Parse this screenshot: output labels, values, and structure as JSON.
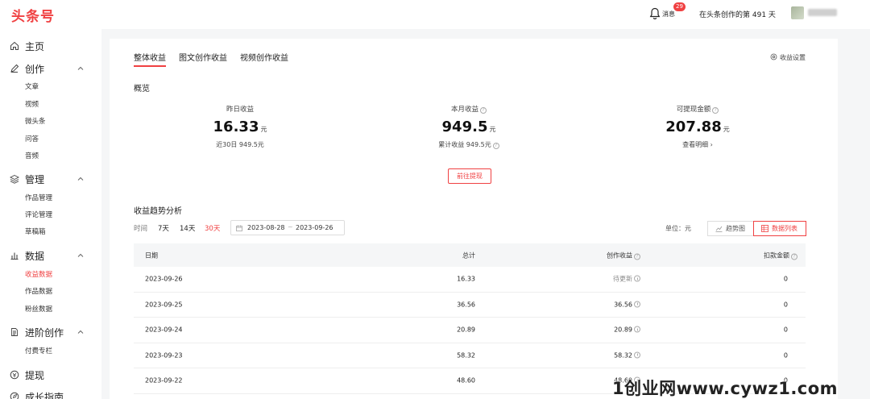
{
  "header": {
    "logo": "头条号",
    "messages_label": "消息",
    "messages_badge": "29",
    "days_text": "在头条创作的第 491 天"
  },
  "sidebar": {
    "sections": [
      {
        "label": "主页",
        "icon": "home-icon"
      },
      {
        "label": "创作",
        "icon": "pen-icon",
        "items": [
          "文章",
          "视频",
          "微头条",
          "问答",
          "音频"
        ]
      },
      {
        "label": "管理",
        "icon": "layers-icon",
        "items": [
          "作品管理",
          "评论管理",
          "草稿箱"
        ]
      },
      {
        "label": "数据",
        "icon": "bar-chart-icon",
        "items": [
          "收益数据",
          "作品数据",
          "粉丝数据"
        ],
        "active_item": "收益数据"
      },
      {
        "label": "进阶创作",
        "icon": "document-icon",
        "items": [
          "付费专栏"
        ]
      },
      {
        "label": "提现",
        "icon": "coin-icon"
      },
      {
        "label": "成长指南",
        "icon": "guide-icon"
      }
    ]
  },
  "tabs": [
    "整体收益",
    "图文创作收益",
    "视频创作收益"
  ],
  "settings_label": "收益设置",
  "overview": {
    "title": "概览",
    "stats": [
      {
        "label": "昨日收益",
        "value": "16.33",
        "unit": "元",
        "sub": "近30日 949.5元"
      },
      {
        "label": "本月收益",
        "value": "949.5",
        "unit": "元",
        "sub": "累计收益 949.5元"
      },
      {
        "label": "可提现金额",
        "value": "207.88",
        "unit": "元",
        "sub": "查看明细 ›"
      }
    ],
    "withdraw_button": "前往提现"
  },
  "trend": {
    "title": "收益趋势分析",
    "time_label": "时间",
    "ranges": [
      "7天",
      "14天",
      "30天"
    ],
    "active_range": "30天",
    "date_start": "2023-08-28",
    "date_sep": "~",
    "date_end": "2023-09-26",
    "unit_label": "单位：元",
    "view_trend": "趋势图",
    "view_list": "数据列表"
  },
  "table": {
    "columns": [
      "日期",
      "总计",
      "创作收益",
      "扣款金额"
    ],
    "rows": [
      {
        "date": "2023-09-26",
        "total": "16.33",
        "creation": "待更新",
        "deduct": "0"
      },
      {
        "date": "2023-09-25",
        "total": "36.56",
        "creation": "36.56",
        "deduct": "0"
      },
      {
        "date": "2023-09-24",
        "total": "20.89",
        "creation": "20.89",
        "deduct": "0"
      },
      {
        "date": "2023-09-23",
        "total": "58.32",
        "creation": "58.32",
        "deduct": "0"
      },
      {
        "date": "2023-09-22",
        "total": "48.60",
        "creation": "48.60",
        "deduct": "0"
      }
    ]
  },
  "watermark": "1创业网www.cywz1.com",
  "colors": {
    "accent": "#f04142",
    "page_bg": "#f5f6f7",
    "card_bg": "#ffffff"
  }
}
